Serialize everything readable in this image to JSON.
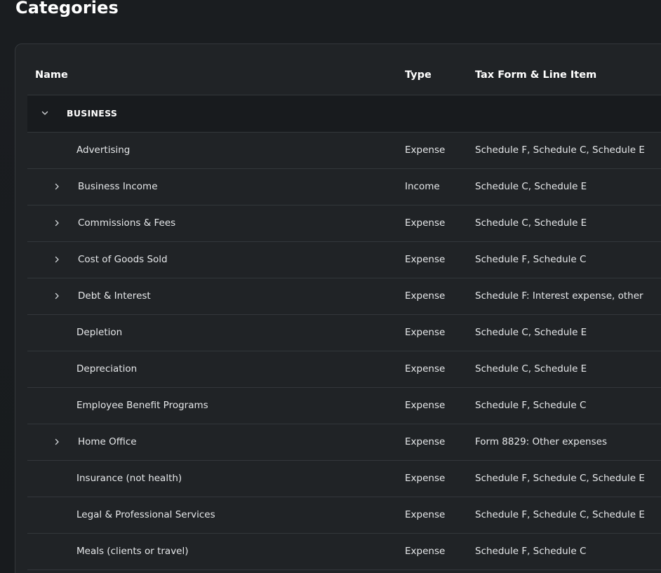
{
  "page": {
    "title": "Categories"
  },
  "table": {
    "headers": {
      "name": "Name",
      "type": "Type",
      "tax": "Tax Form & Line Item"
    },
    "group": {
      "label": "BUSINESS",
      "icon": "chevron-down-icon",
      "expanded": true
    },
    "rows": [
      {
        "name": "Advertising",
        "type": "Expense",
        "tax": "Schedule F, Schedule C, Schedule E",
        "expandable": false
      },
      {
        "name": "Business Income",
        "type": "Income",
        "tax": "Schedule C, Schedule E",
        "expandable": true
      },
      {
        "name": "Commissions & Fees",
        "type": "Expense",
        "tax": "Schedule C, Schedule E",
        "expandable": true
      },
      {
        "name": "Cost of Goods Sold",
        "type": "Expense",
        "tax": "Schedule F, Schedule C",
        "expandable": true
      },
      {
        "name": "Debt & Interest",
        "type": "Expense",
        "tax": "Schedule F: Interest expense, other",
        "expandable": true
      },
      {
        "name": "Depletion",
        "type": "Expense",
        "tax": "Schedule C, Schedule E",
        "expandable": false
      },
      {
        "name": "Depreciation",
        "type": "Expense",
        "tax": "Schedule C, Schedule E",
        "expandable": false
      },
      {
        "name": "Employee Benefit Programs",
        "type": "Expense",
        "tax": "Schedule F, Schedule C",
        "expandable": false
      },
      {
        "name": "Home Office",
        "type": "Expense",
        "tax": "Form 8829: Other expenses",
        "expandable": true
      },
      {
        "name": "Insurance (not health)",
        "type": "Expense",
        "tax": "Schedule F, Schedule C, Schedule E",
        "expandable": false
      },
      {
        "name": "Legal & Professional Services",
        "type": "Expense",
        "tax": "Schedule F, Schedule C, Schedule E",
        "expandable": false
      },
      {
        "name": "Meals (clients or travel)",
        "type": "Expense",
        "tax": "Schedule F, Schedule C",
        "expandable": false
      }
    ]
  },
  "colors": {
    "background": "#181b1e",
    "card": "#202326",
    "group_row": "#181b1e",
    "border": "#33373b",
    "text": "#e6e8ea",
    "heading": "#ffffff"
  }
}
